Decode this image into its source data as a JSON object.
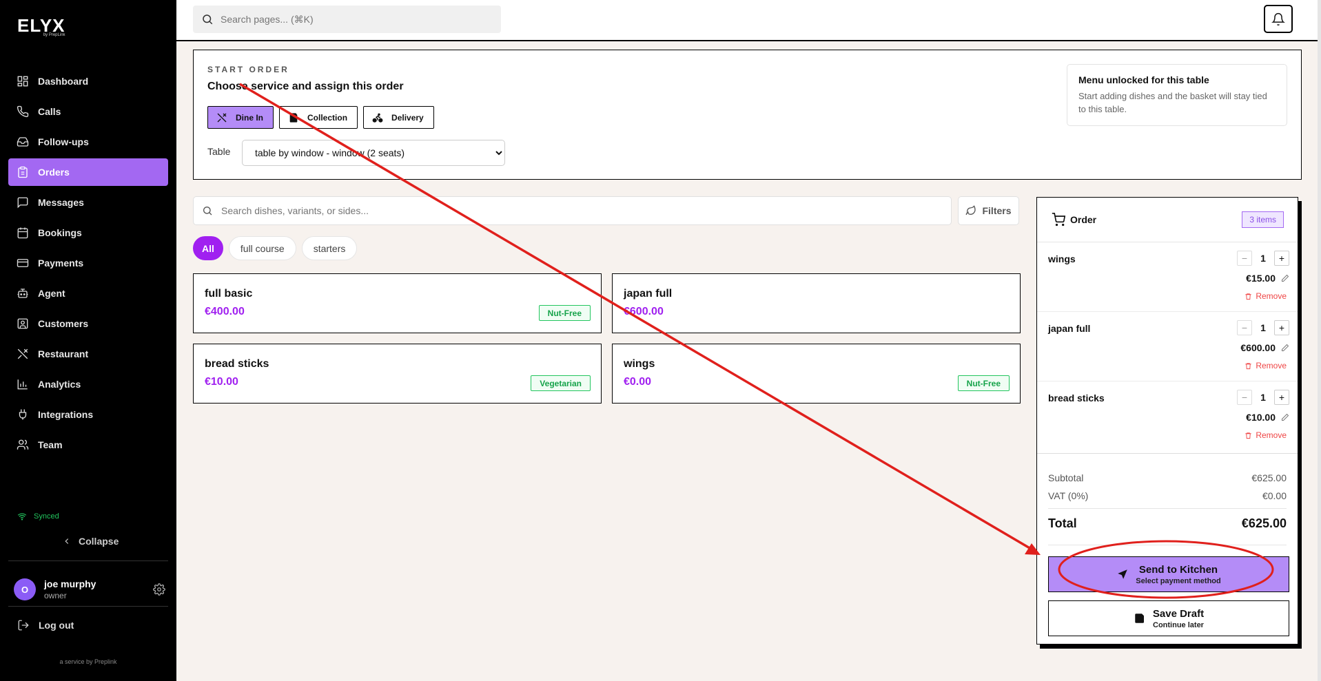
{
  "brand": {
    "name": "ELYX",
    "sub": "by PrepLink",
    "service_text": "a service by Preplink"
  },
  "sidebar": {
    "items": [
      {
        "label": "Dashboard",
        "icon": "dashboard-icon"
      },
      {
        "label": "Calls",
        "icon": "phone-icon"
      },
      {
        "label": "Follow-ups",
        "icon": "inbox-icon"
      },
      {
        "label": "Orders",
        "icon": "clipboard-icon",
        "active": true
      },
      {
        "label": "Messages",
        "icon": "message-icon"
      },
      {
        "label": "Bookings",
        "icon": "calendar-icon"
      },
      {
        "label": "Payments",
        "icon": "card-icon"
      },
      {
        "label": "Agent",
        "icon": "robot-icon"
      },
      {
        "label": "Customers",
        "icon": "contact-icon"
      },
      {
        "label": "Restaurant",
        "icon": "utensils-icon"
      },
      {
        "label": "Analytics",
        "icon": "bar-chart-icon"
      },
      {
        "label": "Integrations",
        "icon": "plug-icon"
      },
      {
        "label": "Team",
        "icon": "users-icon"
      }
    ],
    "status": "Synced",
    "collapse": "Collapse",
    "user": {
      "initial": "O",
      "name": "joe murphy",
      "role": "owner"
    },
    "logout": "Log out"
  },
  "topbar": {
    "search_placeholder": "Search pages... (⌘K)"
  },
  "start_order": {
    "eyebrow": "START ORDER",
    "title": "Choose service and assign this order",
    "services": [
      {
        "label": "Dine In",
        "icon": "utensils-icon",
        "active": true
      },
      {
        "label": "Collection",
        "icon": "bag-icon"
      },
      {
        "label": "Delivery",
        "icon": "bike-icon"
      }
    ],
    "table_label": "Table",
    "table_value": "table by window - window (2 seats)",
    "notice_title": "Menu unlocked for this table",
    "notice_text": "Start adding dishes and the basket will stay tied to this table."
  },
  "menu": {
    "search_placeholder": "Search dishes, variants, or sides...",
    "filters_label": "Filters",
    "categories": [
      "All",
      "full course",
      "starters"
    ],
    "dishes": [
      {
        "name": "full basic",
        "price": "€400.00",
        "tag": "Nut-Free"
      },
      {
        "name": "japan full",
        "price": "€600.00",
        "tag": ""
      },
      {
        "name": "bread sticks",
        "price": "€10.00",
        "tag": "Vegetarian"
      },
      {
        "name": "wings",
        "price": "€0.00",
        "tag": "Nut-Free"
      }
    ]
  },
  "order": {
    "title": "Order",
    "count": "3 items",
    "lines": [
      {
        "name": "wings",
        "qty": "1",
        "price": "€15.00",
        "remove": "Remove"
      },
      {
        "name": "japan full",
        "qty": "1",
        "price": "€600.00",
        "remove": "Remove"
      },
      {
        "name": "bread sticks",
        "qty": "1",
        "price": "€10.00",
        "remove": "Remove"
      }
    ],
    "subtotal_label": "Subtotal",
    "subtotal": "€625.00",
    "vat_label": "VAT (0%)",
    "vat": "€0.00",
    "total_label": "Total",
    "total": "€625.00",
    "send_label": "Send to Kitchen",
    "send_sub": "Select payment method",
    "draft_label": "Save Draft",
    "draft_sub": "Continue later"
  },
  "colors": {
    "accent": "#a368f2",
    "price": "#a020f0",
    "annotation": "#e0201c",
    "tag": "#16a34a"
  }
}
